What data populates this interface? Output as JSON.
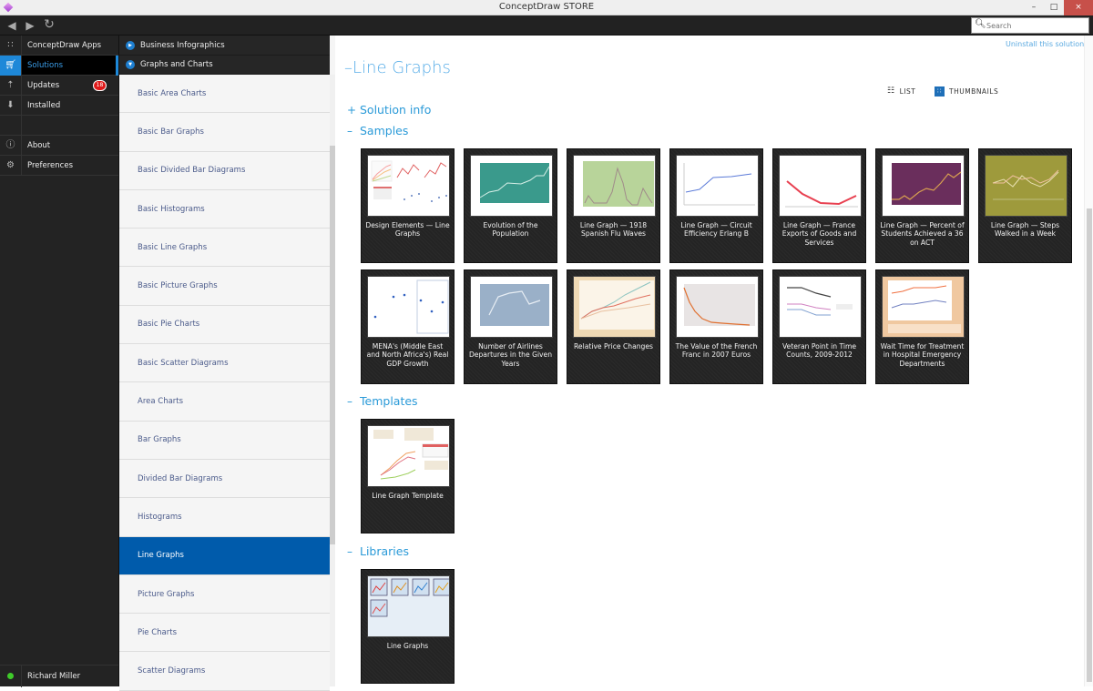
{
  "window": {
    "title": "ConceptDraw STORE",
    "controls": {
      "minimize": "–",
      "maximize": "□",
      "close": "×"
    }
  },
  "toolbar": {
    "back_icon": "◀",
    "forward_icon": "▶",
    "refresh_icon": "↻",
    "search_placeholder": "Search"
  },
  "leftnav": {
    "items": [
      {
        "label": "ConceptDraw Apps",
        "icon": "apps-icon"
      },
      {
        "label": "Solutions",
        "icon": "cart-icon",
        "active": true
      },
      {
        "label": "Updates",
        "icon": "updates-icon",
        "badge": "18"
      },
      {
        "label": "Installed",
        "icon": "download-icon"
      },
      {
        "label": "About",
        "icon": "info-icon"
      },
      {
        "label": "Preferences",
        "icon": "gear-icon"
      }
    ],
    "user": {
      "name": "Richard Miller",
      "status_color": "#3fcb2a"
    }
  },
  "midpanel": {
    "categories": [
      {
        "label": "Business Infographics",
        "expanded": false
      },
      {
        "label": "Graphs and Charts",
        "expanded": true
      }
    ],
    "solutions": [
      "Basic Area Charts",
      "Basic Bar Graphs",
      "Basic Divided Bar Diagrams",
      "Basic Histograms",
      "Basic Line Graphs",
      "Basic Picture Graphs",
      "Basic Pie Charts",
      "Basic Scatter Diagrams",
      "Area Charts",
      "Bar Graphs",
      "Divided Bar Diagrams",
      "Histograms",
      "Line Graphs",
      "Picture Graphs",
      "Pie Charts",
      "Scatter Diagrams"
    ],
    "active_solution": "Line Graphs"
  },
  "main": {
    "uninstall_link": "Uninstall this solution",
    "title_prefix": "–",
    "title": "Line Graphs",
    "view": {
      "list_label": "LIST",
      "thumbnails_label": "THUMBNAILS",
      "selected": "THUMBNAILS"
    },
    "sections": {
      "solution_info": {
        "toggle": "+",
        "label": "Solution info"
      },
      "samples": {
        "toggle": "–",
        "label": "Samples"
      },
      "templates": {
        "toggle": "–",
        "label": "Templates"
      },
      "libraries": {
        "toggle": "–",
        "label": "Libraries"
      }
    },
    "samples": [
      {
        "caption": "Design Elements — Line Graphs",
        "thumb": "multi"
      },
      {
        "caption": "Evolution of the Population",
        "thumb": "teal"
      },
      {
        "caption": "Line Graph — 1918 Spanish Flu Waves",
        "thumb": "green"
      },
      {
        "caption": "Line Graph — Circuit Efficiency Erlang B",
        "thumb": "blue-line"
      },
      {
        "caption": "Line Graph — France Exports of Goods and Services",
        "thumb": "red-line"
      },
      {
        "caption": "Line Graph — Percent of Students Achieved a 36 on ACT",
        "thumb": "purple"
      },
      {
        "caption": "Line Graph — Steps Walked in a Week",
        "thumb": "olive"
      },
      {
        "caption": "MENA's (Middle East and North Africa's) Real GDP Growth",
        "thumb": "scatter"
      },
      {
        "caption": "Number of Airlines Departures in the Given Years",
        "thumb": "slate"
      },
      {
        "caption": "Relative Price Changes",
        "thumb": "tan"
      },
      {
        "caption": "The Value of the French Franc in 2007 Euros",
        "thumb": "decay"
      },
      {
        "caption": "Veteran Point in Time Counts, 2009-2012",
        "thumb": "veteran"
      },
      {
        "caption": "Wait Time for Treatment in Hospital Emergency Departments",
        "thumb": "peach"
      }
    ],
    "templates": [
      {
        "caption": "Line Graph Template",
        "thumb": "template"
      }
    ],
    "libraries": [
      {
        "caption": "Line Graphs",
        "thumb": "library"
      }
    ]
  }
}
